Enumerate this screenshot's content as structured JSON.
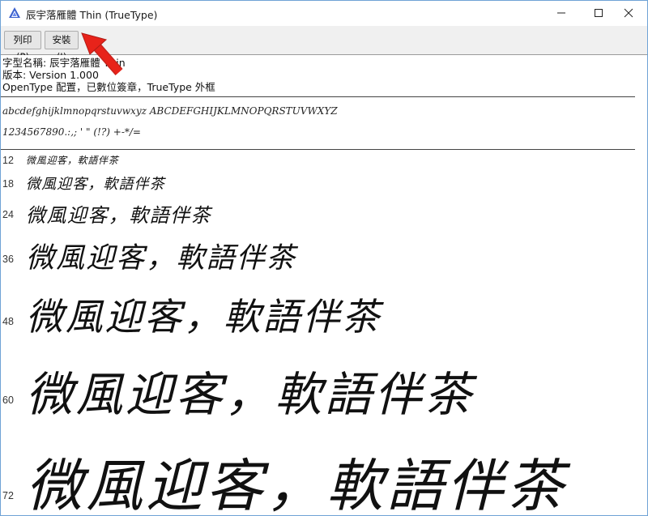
{
  "window": {
    "title": "辰宇落雁體 Thin (TrueType)",
    "app_icon": "font-viewer-icon",
    "minimize_icon": "minimize-icon",
    "maximize_icon": "maximize-icon",
    "close_icon": "close-icon"
  },
  "toolbar": {
    "print_label": "列印(P)",
    "install_label": "安裝(I)"
  },
  "annotation": {
    "arrow_icon": "red-arrow-icon",
    "arrow_color": "#e8231a"
  },
  "info": {
    "font_name": "字型名稱: 辰宇落雁體 Thin",
    "version": "版本: Version 1.000",
    "type": "OpenType 配置，已數位簽章，TrueType 外框"
  },
  "charset": {
    "alphabet": "abcdefghijklmnopqrstuvwxyz ABCDEFGHIJKLMNOPQRSTUVWXYZ",
    "symbols": "1234567890.:,; ' \" (!?) +-*/="
  },
  "samples": [
    {
      "size": "12",
      "text": "微風迎客，軟語伴茶"
    },
    {
      "size": "18",
      "text": "微風迎客，軟語伴茶"
    },
    {
      "size": "24",
      "text": "微風迎客，軟語伴茶"
    },
    {
      "size": "36",
      "text": "微風迎客，軟語伴茶"
    },
    {
      "size": "48",
      "text": "微風迎客，軟語伴茶"
    },
    {
      "size": "60",
      "text": "微風迎客，軟語伴茶"
    },
    {
      "size": "72",
      "text": "微風迎客，軟語伴茶"
    }
  ]
}
